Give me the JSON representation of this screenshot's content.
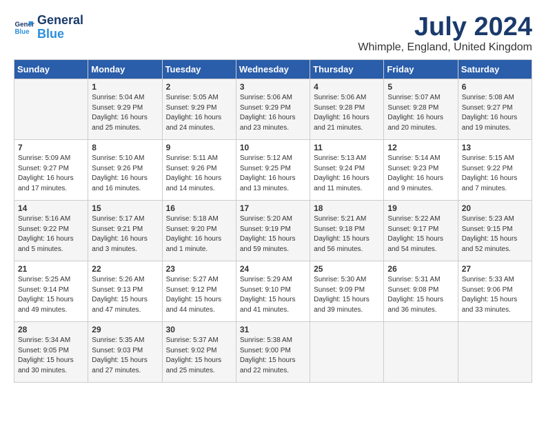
{
  "header": {
    "logo_line1": "General",
    "logo_line2": "Blue",
    "month": "July 2024",
    "location": "Whimple, England, United Kingdom"
  },
  "days_of_week": [
    "Sunday",
    "Monday",
    "Tuesday",
    "Wednesday",
    "Thursday",
    "Friday",
    "Saturday"
  ],
  "weeks": [
    [
      {
        "day": "",
        "info": ""
      },
      {
        "day": "1",
        "info": "Sunrise: 5:04 AM\nSunset: 9:29 PM\nDaylight: 16 hours\nand 25 minutes."
      },
      {
        "day": "2",
        "info": "Sunrise: 5:05 AM\nSunset: 9:29 PM\nDaylight: 16 hours\nand 24 minutes."
      },
      {
        "day": "3",
        "info": "Sunrise: 5:06 AM\nSunset: 9:29 PM\nDaylight: 16 hours\nand 23 minutes."
      },
      {
        "day": "4",
        "info": "Sunrise: 5:06 AM\nSunset: 9:28 PM\nDaylight: 16 hours\nand 21 minutes."
      },
      {
        "day": "5",
        "info": "Sunrise: 5:07 AM\nSunset: 9:28 PM\nDaylight: 16 hours\nand 20 minutes."
      },
      {
        "day": "6",
        "info": "Sunrise: 5:08 AM\nSunset: 9:27 PM\nDaylight: 16 hours\nand 19 minutes."
      }
    ],
    [
      {
        "day": "7",
        "info": "Sunrise: 5:09 AM\nSunset: 9:27 PM\nDaylight: 16 hours\nand 17 minutes."
      },
      {
        "day": "8",
        "info": "Sunrise: 5:10 AM\nSunset: 9:26 PM\nDaylight: 16 hours\nand 16 minutes."
      },
      {
        "day": "9",
        "info": "Sunrise: 5:11 AM\nSunset: 9:26 PM\nDaylight: 16 hours\nand 14 minutes."
      },
      {
        "day": "10",
        "info": "Sunrise: 5:12 AM\nSunset: 9:25 PM\nDaylight: 16 hours\nand 13 minutes."
      },
      {
        "day": "11",
        "info": "Sunrise: 5:13 AM\nSunset: 9:24 PM\nDaylight: 16 hours\nand 11 minutes."
      },
      {
        "day": "12",
        "info": "Sunrise: 5:14 AM\nSunset: 9:23 PM\nDaylight: 16 hours\nand 9 minutes."
      },
      {
        "day": "13",
        "info": "Sunrise: 5:15 AM\nSunset: 9:22 PM\nDaylight: 16 hours\nand 7 minutes."
      }
    ],
    [
      {
        "day": "14",
        "info": "Sunrise: 5:16 AM\nSunset: 9:22 PM\nDaylight: 16 hours\nand 5 minutes."
      },
      {
        "day": "15",
        "info": "Sunrise: 5:17 AM\nSunset: 9:21 PM\nDaylight: 16 hours\nand 3 minutes."
      },
      {
        "day": "16",
        "info": "Sunrise: 5:18 AM\nSunset: 9:20 PM\nDaylight: 16 hours\nand 1 minute."
      },
      {
        "day": "17",
        "info": "Sunrise: 5:20 AM\nSunset: 9:19 PM\nDaylight: 15 hours\nand 59 minutes."
      },
      {
        "day": "18",
        "info": "Sunrise: 5:21 AM\nSunset: 9:18 PM\nDaylight: 15 hours\nand 56 minutes."
      },
      {
        "day": "19",
        "info": "Sunrise: 5:22 AM\nSunset: 9:17 PM\nDaylight: 15 hours\nand 54 minutes."
      },
      {
        "day": "20",
        "info": "Sunrise: 5:23 AM\nSunset: 9:15 PM\nDaylight: 15 hours\nand 52 minutes."
      }
    ],
    [
      {
        "day": "21",
        "info": "Sunrise: 5:25 AM\nSunset: 9:14 PM\nDaylight: 15 hours\nand 49 minutes."
      },
      {
        "day": "22",
        "info": "Sunrise: 5:26 AM\nSunset: 9:13 PM\nDaylight: 15 hours\nand 47 minutes."
      },
      {
        "day": "23",
        "info": "Sunrise: 5:27 AM\nSunset: 9:12 PM\nDaylight: 15 hours\nand 44 minutes."
      },
      {
        "day": "24",
        "info": "Sunrise: 5:29 AM\nSunset: 9:10 PM\nDaylight: 15 hours\nand 41 minutes."
      },
      {
        "day": "25",
        "info": "Sunrise: 5:30 AM\nSunset: 9:09 PM\nDaylight: 15 hours\nand 39 minutes."
      },
      {
        "day": "26",
        "info": "Sunrise: 5:31 AM\nSunset: 9:08 PM\nDaylight: 15 hours\nand 36 minutes."
      },
      {
        "day": "27",
        "info": "Sunrise: 5:33 AM\nSunset: 9:06 PM\nDaylight: 15 hours\nand 33 minutes."
      }
    ],
    [
      {
        "day": "28",
        "info": "Sunrise: 5:34 AM\nSunset: 9:05 PM\nDaylight: 15 hours\nand 30 minutes."
      },
      {
        "day": "29",
        "info": "Sunrise: 5:35 AM\nSunset: 9:03 PM\nDaylight: 15 hours\nand 27 minutes."
      },
      {
        "day": "30",
        "info": "Sunrise: 5:37 AM\nSunset: 9:02 PM\nDaylight: 15 hours\nand 25 minutes."
      },
      {
        "day": "31",
        "info": "Sunrise: 5:38 AM\nSunset: 9:00 PM\nDaylight: 15 hours\nand 22 minutes."
      },
      {
        "day": "",
        "info": ""
      },
      {
        "day": "",
        "info": ""
      },
      {
        "day": "",
        "info": ""
      }
    ]
  ]
}
